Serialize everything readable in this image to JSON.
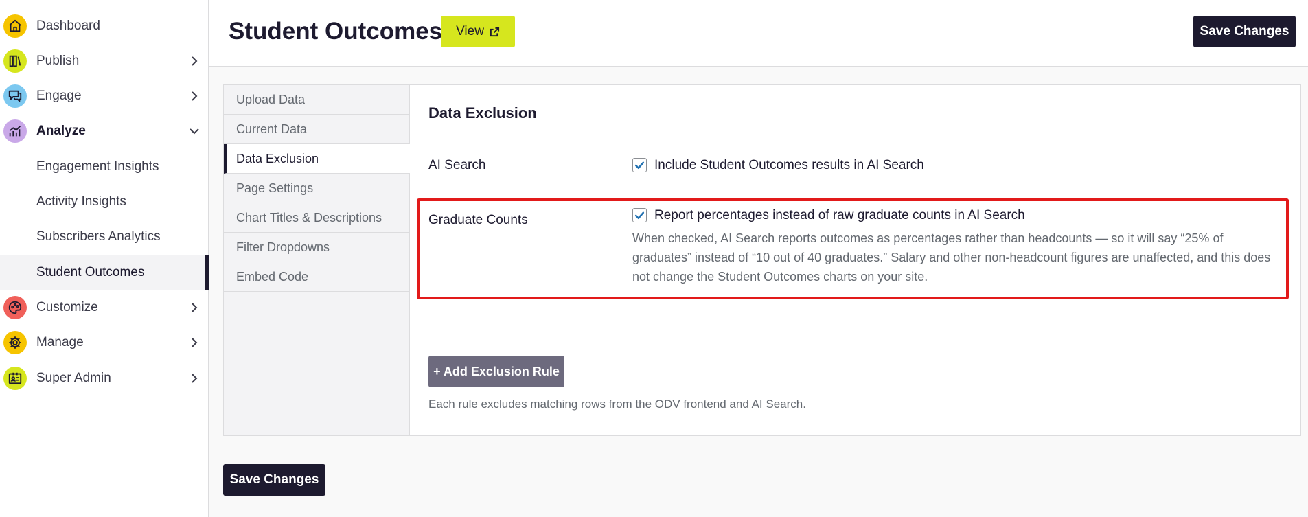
{
  "sidebar": {
    "items": [
      {
        "label": "Dashboard",
        "icon": "home-icon",
        "color": "#f6c400"
      },
      {
        "label": "Publish",
        "icon": "publish-icon",
        "color": "#d6e61e"
      },
      {
        "label": "Engage",
        "icon": "chat-icon",
        "color": "#7cc8f0"
      },
      {
        "label": "Analyze",
        "icon": "analytics-icon",
        "color": "#c9a8e8"
      },
      {
        "label": "Customize",
        "icon": "palette-icon",
        "color": "#f0605a"
      },
      {
        "label": "Manage",
        "icon": "gear-icon",
        "color": "#f6c400"
      },
      {
        "label": "Super Admin",
        "icon": "id-badge-icon",
        "color": "#d6e61e"
      }
    ],
    "sub_items": [
      {
        "label": "Engagement Insights"
      },
      {
        "label": "Activity Insights"
      },
      {
        "label": "Subscribers Analytics"
      },
      {
        "label": "Student Outcomes"
      }
    ]
  },
  "header": {
    "title": "Student Outcomes",
    "view_label": "View",
    "save_label": "Save Changes"
  },
  "tabs": [
    {
      "label": "Upload Data"
    },
    {
      "label": "Current Data"
    },
    {
      "label": "Data Exclusion"
    },
    {
      "label": "Page Settings"
    },
    {
      "label": "Chart Titles & Descriptions"
    },
    {
      "label": "Filter Dropdowns"
    },
    {
      "label": "Embed Code"
    }
  ],
  "content": {
    "section_title": "Data Exclusion",
    "ai_search": {
      "label": "AI Search",
      "checkbox_label": "Include Student Outcomes results in AI Search",
      "checked": true
    },
    "graduate_counts": {
      "label": "Graduate Counts",
      "checkbox_label": "Report percentages instead of raw graduate counts in AI Search",
      "checked": true,
      "description": "When checked, AI Search reports outcomes as percentages rather than headcounts — so it will say “25% of graduates” instead of “10 out of 40 graduates.” Salary and other non-headcount figures are unaffected, and this does not change the Student Outcomes charts on your site."
    },
    "add_rule_label": "+ Add Exclusion Rule",
    "help_text": "Each rule excludes matching rows from the ODV frontend and AI Search."
  },
  "footer": {
    "save_label": "Save Changes"
  },
  "colors": {
    "brand_dark": "#1d1a2f",
    "accent_yellow": "#d6e61e",
    "highlight_red": "#e21a1a",
    "checkbox_blue": "#2271b1"
  }
}
